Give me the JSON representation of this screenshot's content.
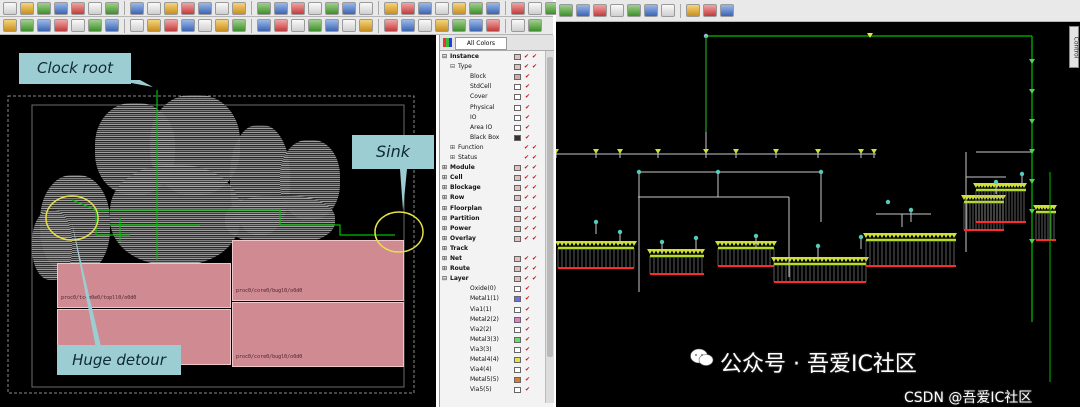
{
  "colors": {
    "macro_fill": "#cf8a92",
    "callout_fill": "#9bcdd3",
    "clock_net": "#00c000",
    "highlight_circle": "#e6e04a",
    "sink_cells": "#b7e61b",
    "sink_pins": "#ff2a2a",
    "tree_wire": "#c8c8c8",
    "canvas_bg": "#000000"
  },
  "layout_view": {
    "callouts": {
      "clock_root": "Clock root",
      "sink": "Sink",
      "huge_detour": "Huge detour"
    },
    "macros": [
      {
        "label": "proc0/tc4m0e0/topll0/o0d0"
      },
      {
        "label": "proc0/core0/bugl0/o0d0"
      },
      {
        "label": ""
      },
      {
        "label": "proc0/core0/bugl0/o0d0"
      }
    ]
  },
  "layer_panel": {
    "tab_label": "All Colors",
    "rows": [
      {
        "label": "Instance",
        "indent": 0,
        "expand": "-",
        "header": true,
        "swatch": "#e0c0c0",
        "checks": 2
      },
      {
        "label": "Type",
        "indent": 1,
        "expand": "-",
        "header": false,
        "swatch": "#e0c0c0",
        "checks": 2
      },
      {
        "label": "Block",
        "indent": 2,
        "expand": "",
        "header": false,
        "swatch": "#d7a8ad",
        "checks": 1
      },
      {
        "label": "StdCell",
        "indent": 2,
        "expand": "",
        "header": false,
        "swatch": "#ffffff",
        "checks": 1
      },
      {
        "label": "Cover",
        "indent": 2,
        "expand": "",
        "header": false,
        "swatch": "#ffffff",
        "checks": 1
      },
      {
        "label": "Physical",
        "indent": 2,
        "expand": "",
        "header": false,
        "swatch": "#ffffff",
        "checks": 1
      },
      {
        "label": "IO",
        "indent": 2,
        "expand": "",
        "header": false,
        "swatch": "#ffffff",
        "checks": 1
      },
      {
        "label": "Area IO",
        "indent": 2,
        "expand": "",
        "header": false,
        "swatch": "#ffffff",
        "checks": 1
      },
      {
        "label": "Black Box",
        "indent": 2,
        "expand": "",
        "header": false,
        "swatch": "#333333",
        "checks": 1
      },
      {
        "label": "Function",
        "indent": 1,
        "expand": "+",
        "header": false,
        "swatch": "",
        "checks": 2
      },
      {
        "label": "Status",
        "indent": 1,
        "expand": "+",
        "header": false,
        "swatch": "",
        "checks": 2
      },
      {
        "label": "Module",
        "indent": 0,
        "expand": "+",
        "header": true,
        "swatch": "#e0c0c0",
        "checks": 2
      },
      {
        "label": "Cell",
        "indent": 0,
        "expand": "+",
        "header": true,
        "swatch": "#e0c0c0",
        "checks": 2
      },
      {
        "label": "Blockage",
        "indent": 0,
        "expand": "+",
        "header": true,
        "swatch": "#e0c0c0",
        "checks": 2
      },
      {
        "label": "Row",
        "indent": 0,
        "expand": "+",
        "header": true,
        "swatch": "#e0c0c0",
        "checks": 2
      },
      {
        "label": "Floorplan",
        "indent": 0,
        "expand": "+",
        "header": true,
        "swatch": "#e0c0c0",
        "checks": 2
      },
      {
        "label": "Partition",
        "indent": 0,
        "expand": "+",
        "header": true,
        "swatch": "#e0c0c0",
        "checks": 2
      },
      {
        "label": "Power",
        "indent": 0,
        "expand": "+",
        "header": true,
        "swatch": "#e0c0c0",
        "checks": 2
      },
      {
        "label": "Overlay",
        "indent": 0,
        "expand": "+",
        "header": true,
        "swatch": "#e0c0c0",
        "checks": 2
      },
      {
        "label": "Track",
        "indent": 0,
        "expand": "+",
        "header": true,
        "swatch": "",
        "checks": 0
      },
      {
        "label": "Net",
        "indent": 0,
        "expand": "+",
        "header": true,
        "swatch": "#e0c0c0",
        "checks": 2
      },
      {
        "label": "Route",
        "indent": 0,
        "expand": "+",
        "header": true,
        "swatch": "#e0c0c0",
        "checks": 2
      },
      {
        "label": "Layer",
        "indent": 0,
        "expand": "-",
        "header": true,
        "swatch": "#e0c0c0",
        "checks": 2
      },
      {
        "label": "Oxide(0)",
        "indent": 2,
        "expand": "",
        "header": false,
        "swatch": "#ffffff",
        "checks": 1
      },
      {
        "label": "Metal1(1)",
        "indent": 2,
        "expand": "",
        "header": false,
        "swatch": "#6f6fe8",
        "checks": 1
      },
      {
        "label": "Via1(1)",
        "indent": 2,
        "expand": "",
        "header": false,
        "swatch": "#ffffff",
        "checks": 1
      },
      {
        "label": "Metal2(2)",
        "indent": 2,
        "expand": "",
        "header": false,
        "swatch": "#e77ad4",
        "checks": 1
      },
      {
        "label": "Via2(2)",
        "indent": 2,
        "expand": "",
        "header": false,
        "swatch": "#ffffff",
        "checks": 1
      },
      {
        "label": "Metal3(3)",
        "indent": 2,
        "expand": "",
        "header": false,
        "swatch": "#66dd66",
        "checks": 1
      },
      {
        "label": "Via3(3)",
        "indent": 2,
        "expand": "",
        "header": false,
        "swatch": "#ffffff",
        "checks": 1
      },
      {
        "label": "Metal4(4)",
        "indent": 2,
        "expand": "",
        "header": false,
        "swatch": "#e6e04a",
        "checks": 1
      },
      {
        "label": "Via4(4)",
        "indent": 2,
        "expand": "",
        "header": false,
        "swatch": "#ffffff",
        "checks": 1
      },
      {
        "label": "Metal5(5)",
        "indent": 2,
        "expand": "",
        "header": false,
        "swatch": "#e07a2a",
        "checks": 1
      },
      {
        "label": "Via5(5)",
        "indent": 2,
        "expand": "",
        "header": false,
        "swatch": "#ffffff",
        "checks": 1
      }
    ]
  },
  "tree_view": {
    "side_tab_label": "Control"
  },
  "watermark": {
    "account": "公众号 · 吾爱IC社区",
    "source": "CSDN @吾爱IC社区"
  }
}
